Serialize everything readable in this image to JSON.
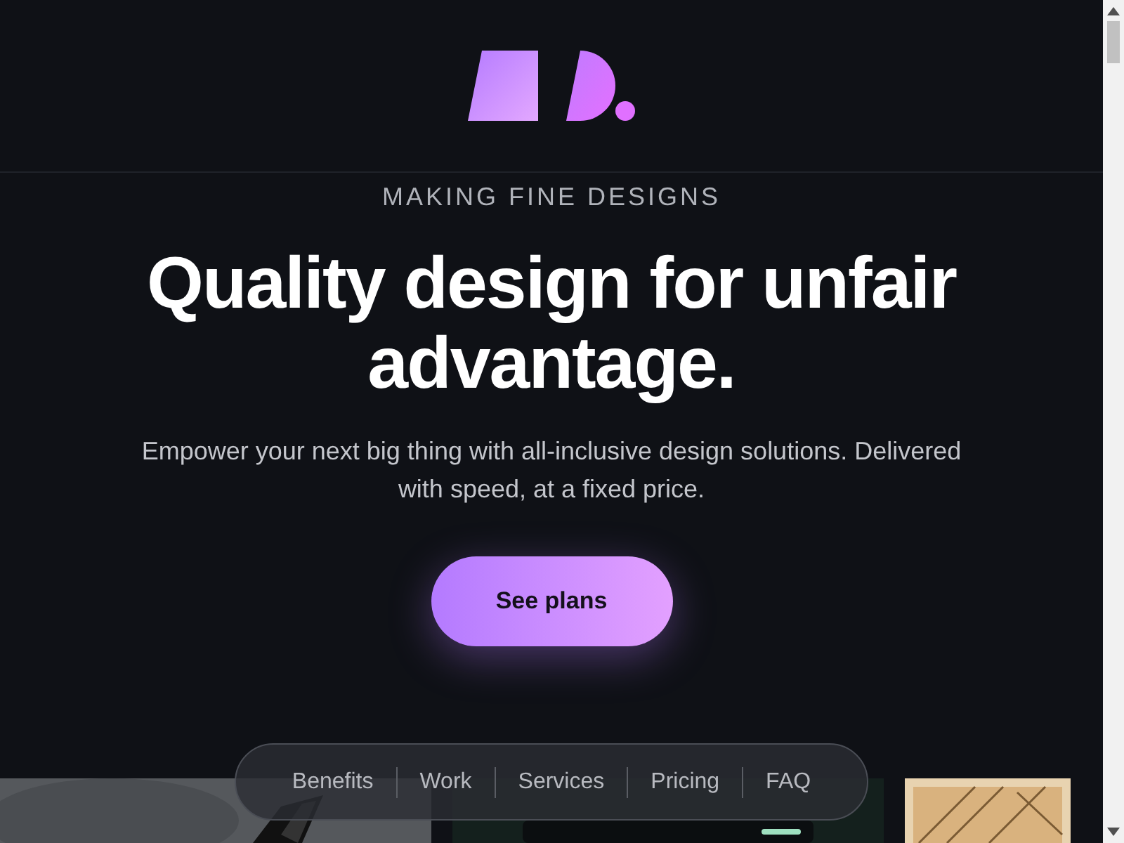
{
  "hero": {
    "eyebrow": "MAKING FINE DESIGNS",
    "heading": "Quality design for unfair advantage.",
    "subtitle": "Empower your next big thing with all-inclusive design solutions. Delivered with speed, at a fixed price.",
    "cta": "See plans"
  },
  "nav": [
    "Benefits",
    "Work",
    "Services",
    "Pricing",
    "FAQ"
  ]
}
